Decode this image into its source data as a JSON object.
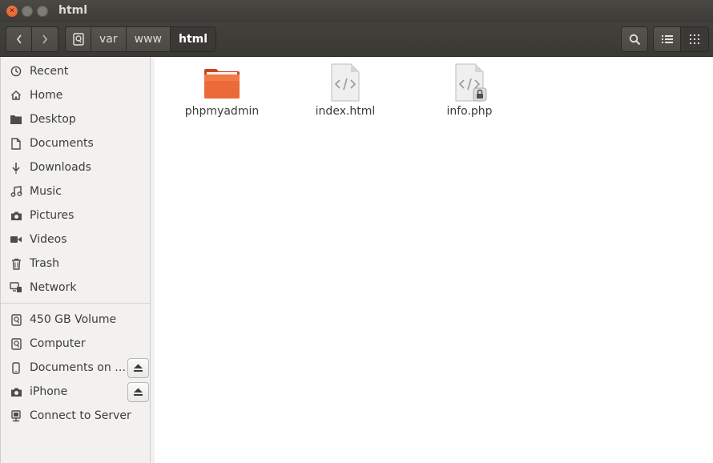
{
  "window": {
    "title": "html"
  },
  "toolbar": {
    "breadcrumbs": [
      "var",
      "www",
      "html"
    ]
  },
  "sidebar": {
    "places": [
      {
        "label": "Recent",
        "icon": "clock-icon"
      },
      {
        "label": "Home",
        "icon": "home-icon"
      },
      {
        "label": "Desktop",
        "icon": "folder-icon"
      },
      {
        "label": "Documents",
        "icon": "document-icon"
      },
      {
        "label": "Downloads",
        "icon": "download-icon"
      },
      {
        "label": "Music",
        "icon": "music-icon"
      },
      {
        "label": "Pictures",
        "icon": "camera-icon"
      },
      {
        "label": "Videos",
        "icon": "video-icon"
      },
      {
        "label": "Trash",
        "icon": "trash-icon"
      },
      {
        "label": "Network",
        "icon": "network-icon"
      }
    ],
    "devices": [
      {
        "label": "450 GB Volume",
        "icon": "drive-icon"
      },
      {
        "label": "Computer",
        "icon": "drive-icon"
      },
      {
        "label": "Documents on …",
        "icon": "phone-icon",
        "eject": true
      },
      {
        "label": "iPhone",
        "icon": "camera-icon",
        "eject": true
      },
      {
        "label": "Connect to Server",
        "icon": "server-icon"
      }
    ]
  },
  "files": [
    {
      "name": "phpmyadmin",
      "type": "folder"
    },
    {
      "name": "index.html",
      "type": "html"
    },
    {
      "name": "info.php",
      "type": "php-locked"
    }
  ],
  "colors": {
    "folder": "#e8592a",
    "titlebar": "#3c3b37",
    "close_button": "#e95420"
  }
}
